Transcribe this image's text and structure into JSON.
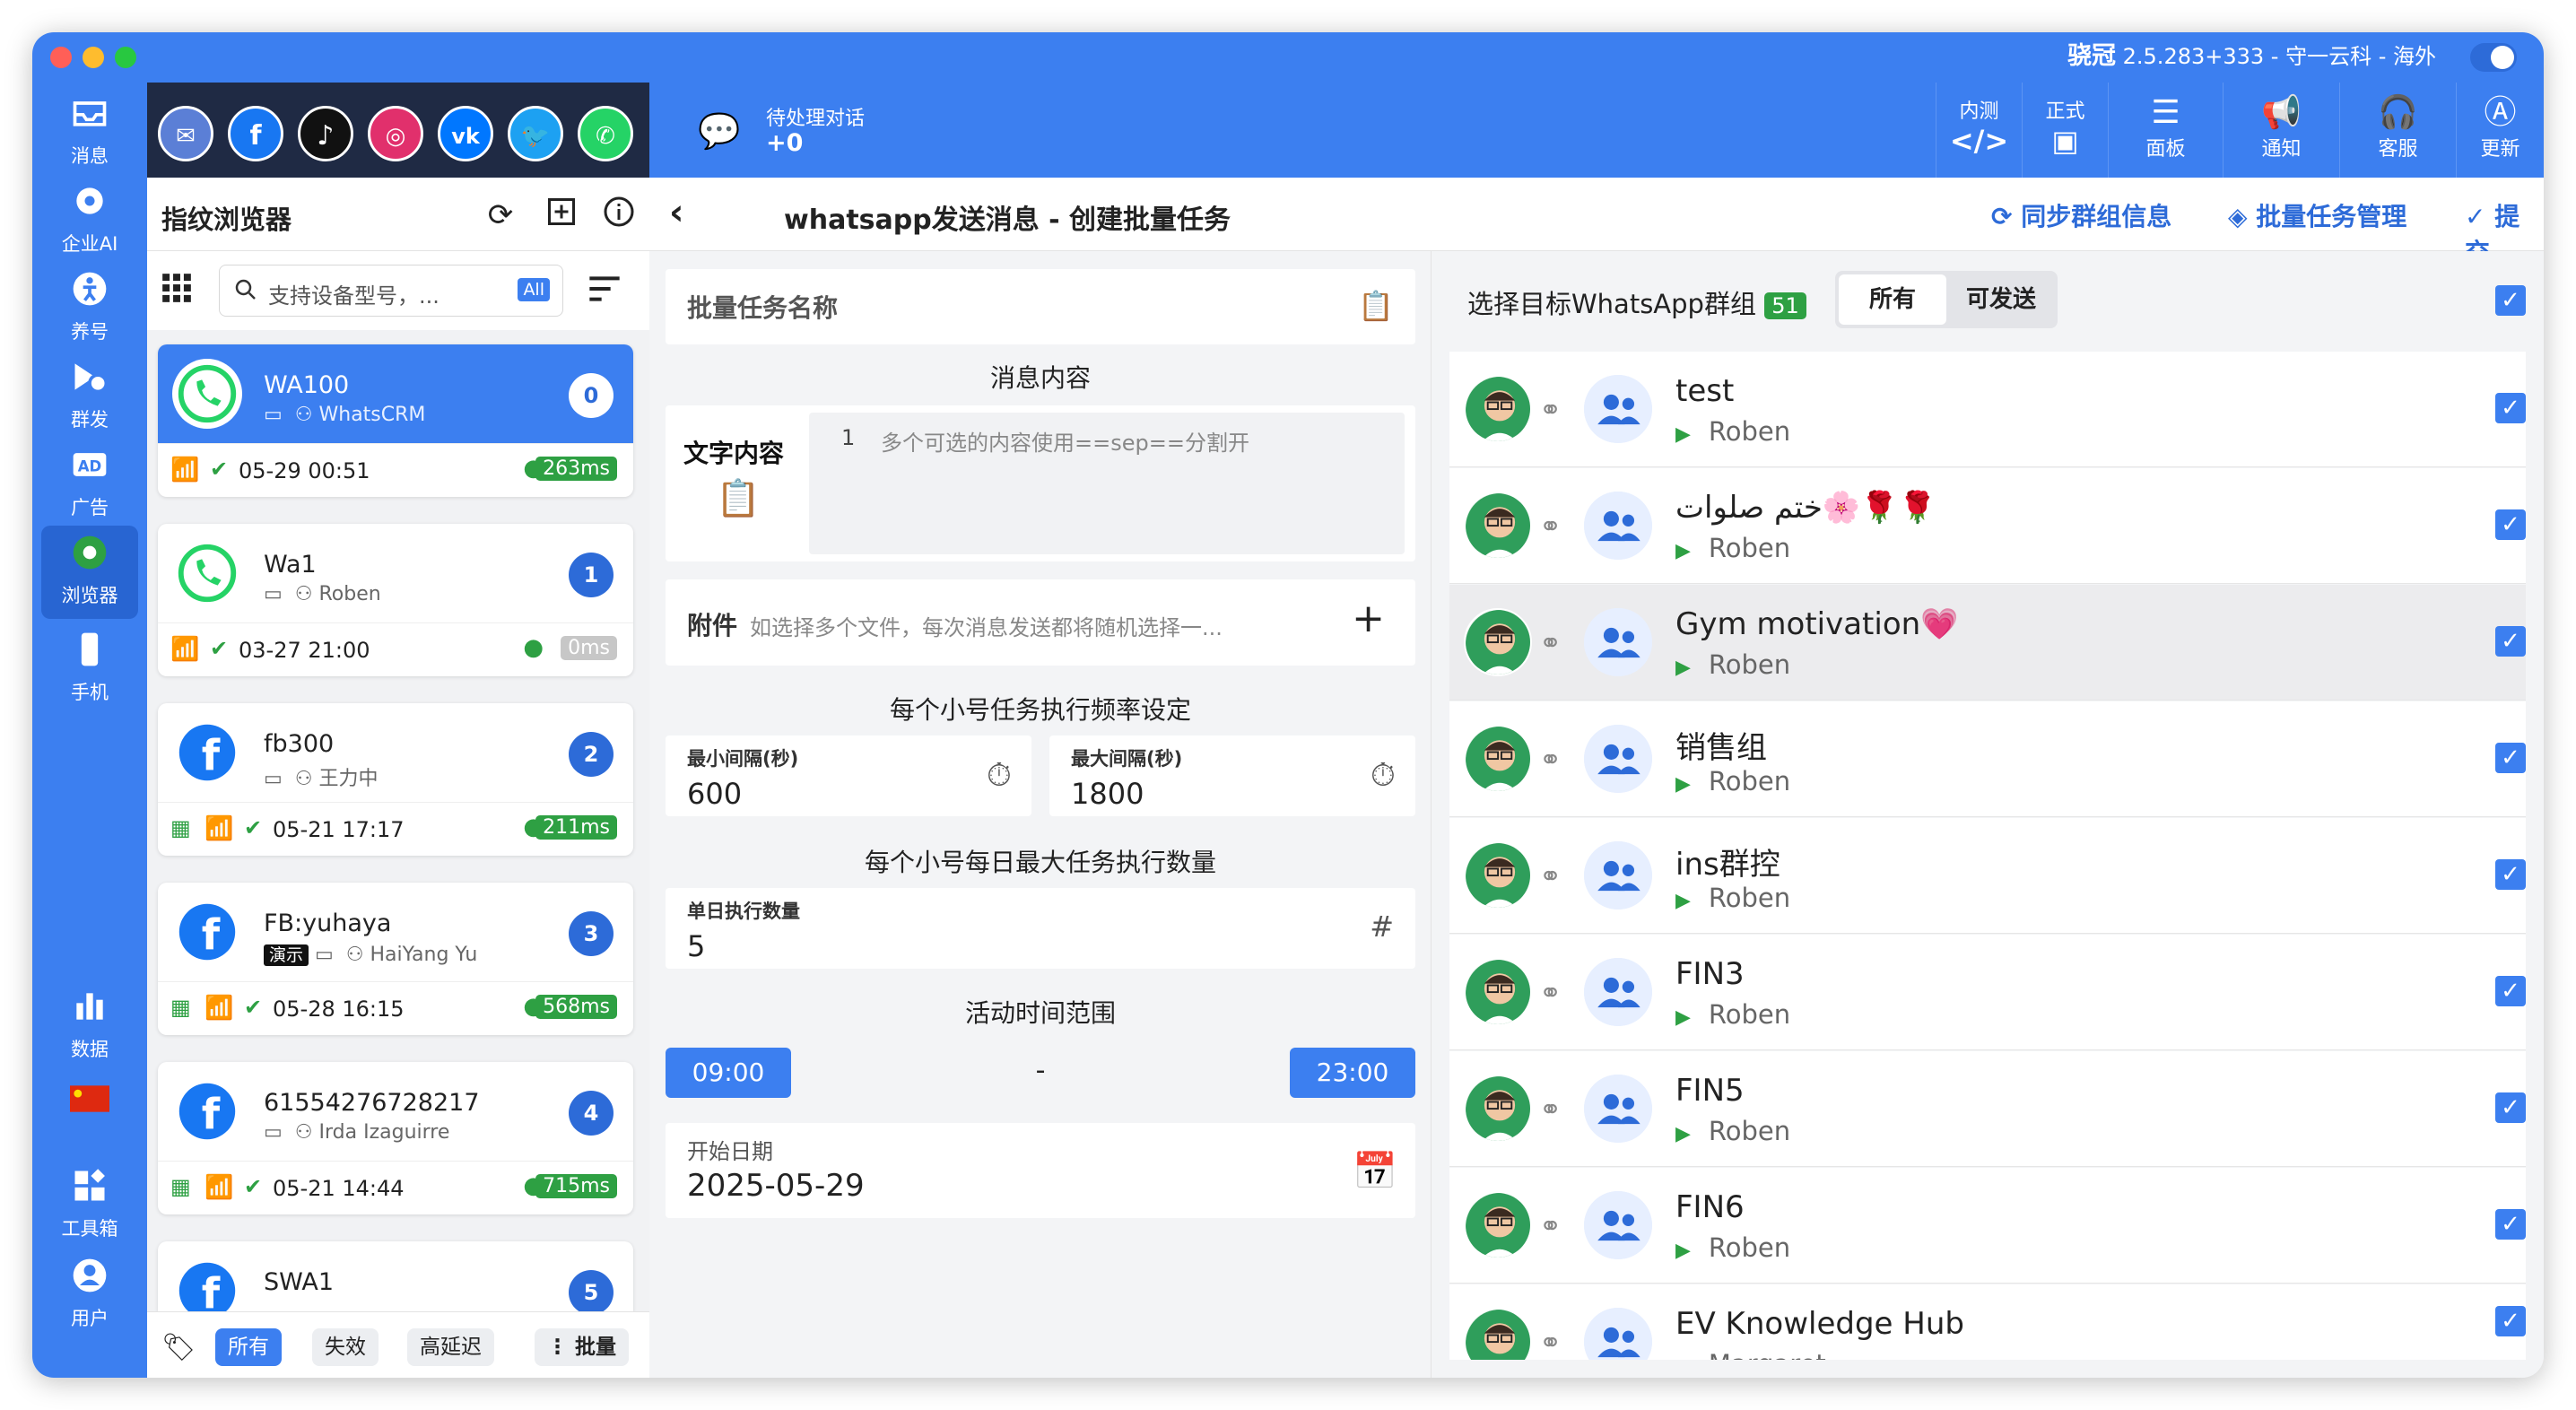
{
  "window": {
    "title": "骁冠",
    "title_rest": "2.5.283+333 - 守一云科 - 海外"
  },
  "left_nav": [
    {
      "label": "消息",
      "icon": "inbox-icon"
    },
    {
      "label": "企业AI",
      "icon": "ai-icon"
    },
    {
      "label": "养号",
      "icon": "person-icon"
    },
    {
      "label": "群发",
      "icon": "broadcast-icon"
    },
    {
      "label": "广告",
      "icon": "ad-icon"
    },
    {
      "label": "浏览器",
      "icon": "chrome-icon"
    },
    {
      "label": "手机",
      "icon": "phone-icon"
    },
    {
      "label": "数据",
      "icon": "bar-chart-icon"
    },
    {
      "label": "工具箱",
      "icon": "toolbox-icon"
    },
    {
      "label": "用户",
      "icon": "user-icon"
    }
  ],
  "social_icons": [
    "messenger-icon",
    "facebook-icon",
    "tiktok-icon",
    "instagram-icon",
    "vk-icon",
    "twitter-icon",
    "whatsapp-icon"
  ],
  "browser_panel": {
    "title": "指纹浏览器",
    "search_placeholder": "支持设备型号，...",
    "all_badge": "All",
    "profiles": [
      {
        "name": "WA100",
        "owner": "WhatsCRM",
        "num": "0",
        "date": "05-29 00:51",
        "latency": "263ms",
        "selected": true
      },
      {
        "name": "Wa1",
        "owner": "Roben",
        "num": "1",
        "date": "03-27 21:00",
        "latency": "0ms"
      },
      {
        "name": "fb300",
        "owner": "王力中",
        "num": "2",
        "date": "05-21 17:17",
        "latency": "211ms"
      },
      {
        "name": "FB:yuhaya",
        "owner": "HaiYang Yu",
        "tag": "演示",
        "num": "3",
        "date": "05-28 16:15",
        "latency": "568ms"
      },
      {
        "name": "61554276728217",
        "owner": "Irda Izaguirre",
        "num": "4",
        "date": "05-21 14:44",
        "latency": "715ms"
      },
      {
        "name": "SWA1",
        "num": "5"
      }
    ],
    "filters": [
      "所有",
      "失效",
      "高延迟"
    ],
    "batch_label": "批量"
  },
  "top_bar": {
    "pending_label": "待处理对话",
    "pending_value": "+0",
    "buttons": [
      {
        "top": "内测",
        "icon": "code-icon"
      },
      {
        "top": "正式",
        "icon": "monitor-icon"
      },
      {
        "label": "面板",
        "icon": "sliders-icon"
      },
      {
        "label": "通知",
        "icon": "megaphone-icon"
      },
      {
        "label": "客服",
        "icon": "headset-icon"
      },
      {
        "label": "更新",
        "icon": "appstore-icon"
      }
    ]
  },
  "page": {
    "title": "whatsapp发送消息 - 创建批量任务",
    "actions": {
      "sync": "同步群组信息",
      "manage": "批量任务管理",
      "submit": "提交"
    }
  },
  "form": {
    "task_name_placeholder": "批量任务名称",
    "message_section": "消息内容",
    "text_content_label": "文字内容",
    "line_no": "1",
    "text_placeholder": "多个可选的内容使用==sep==分割开",
    "attachment_label": "附件",
    "attachment_hint": "如选择多个文件，每次消息发送都将随机选择一...",
    "freq_section": "每个小号任务执行频率设定",
    "min_interval_label": "最小间隔(秒)",
    "min_interval": "600",
    "max_interval_label": "最大间隔(秒)",
    "max_interval": "1800",
    "daily_section": "每个小号每日最大任务执行数量",
    "daily_label": "单日执行数量",
    "daily_value": "5",
    "active_section": "活动时间范围",
    "start_time": "09:00",
    "dash": "-",
    "end_time": "23:00",
    "start_date_label": "开始日期",
    "start_date": "2025-05-29"
  },
  "groups": {
    "header": "选择目标WhatsApp群组",
    "count": "51",
    "seg": [
      "所有",
      "可发送"
    ],
    "items": [
      {
        "name": "test",
        "owner": "Roben"
      },
      {
        "name": "ختم صلوات🌸🌹🌹",
        "owner": "Roben"
      },
      {
        "name": "Gym motivation💗",
        "owner": "Roben",
        "highlight": true
      },
      {
        "name": "销售组",
        "owner": "Roben"
      },
      {
        "name": "ins群控",
        "owner": "Roben"
      },
      {
        "name": "FIN3",
        "owner": "Roben"
      },
      {
        "name": "FIN5",
        "owner": "Roben"
      },
      {
        "name": "FIN6",
        "owner": "Roben"
      },
      {
        "name": "EV Knowledge Hub",
        "owner": "Margaret"
      }
    ]
  },
  "colors": {
    "primary": "#3c7ff0",
    "dark": "#1f2a44",
    "green": "#2ea043"
  }
}
